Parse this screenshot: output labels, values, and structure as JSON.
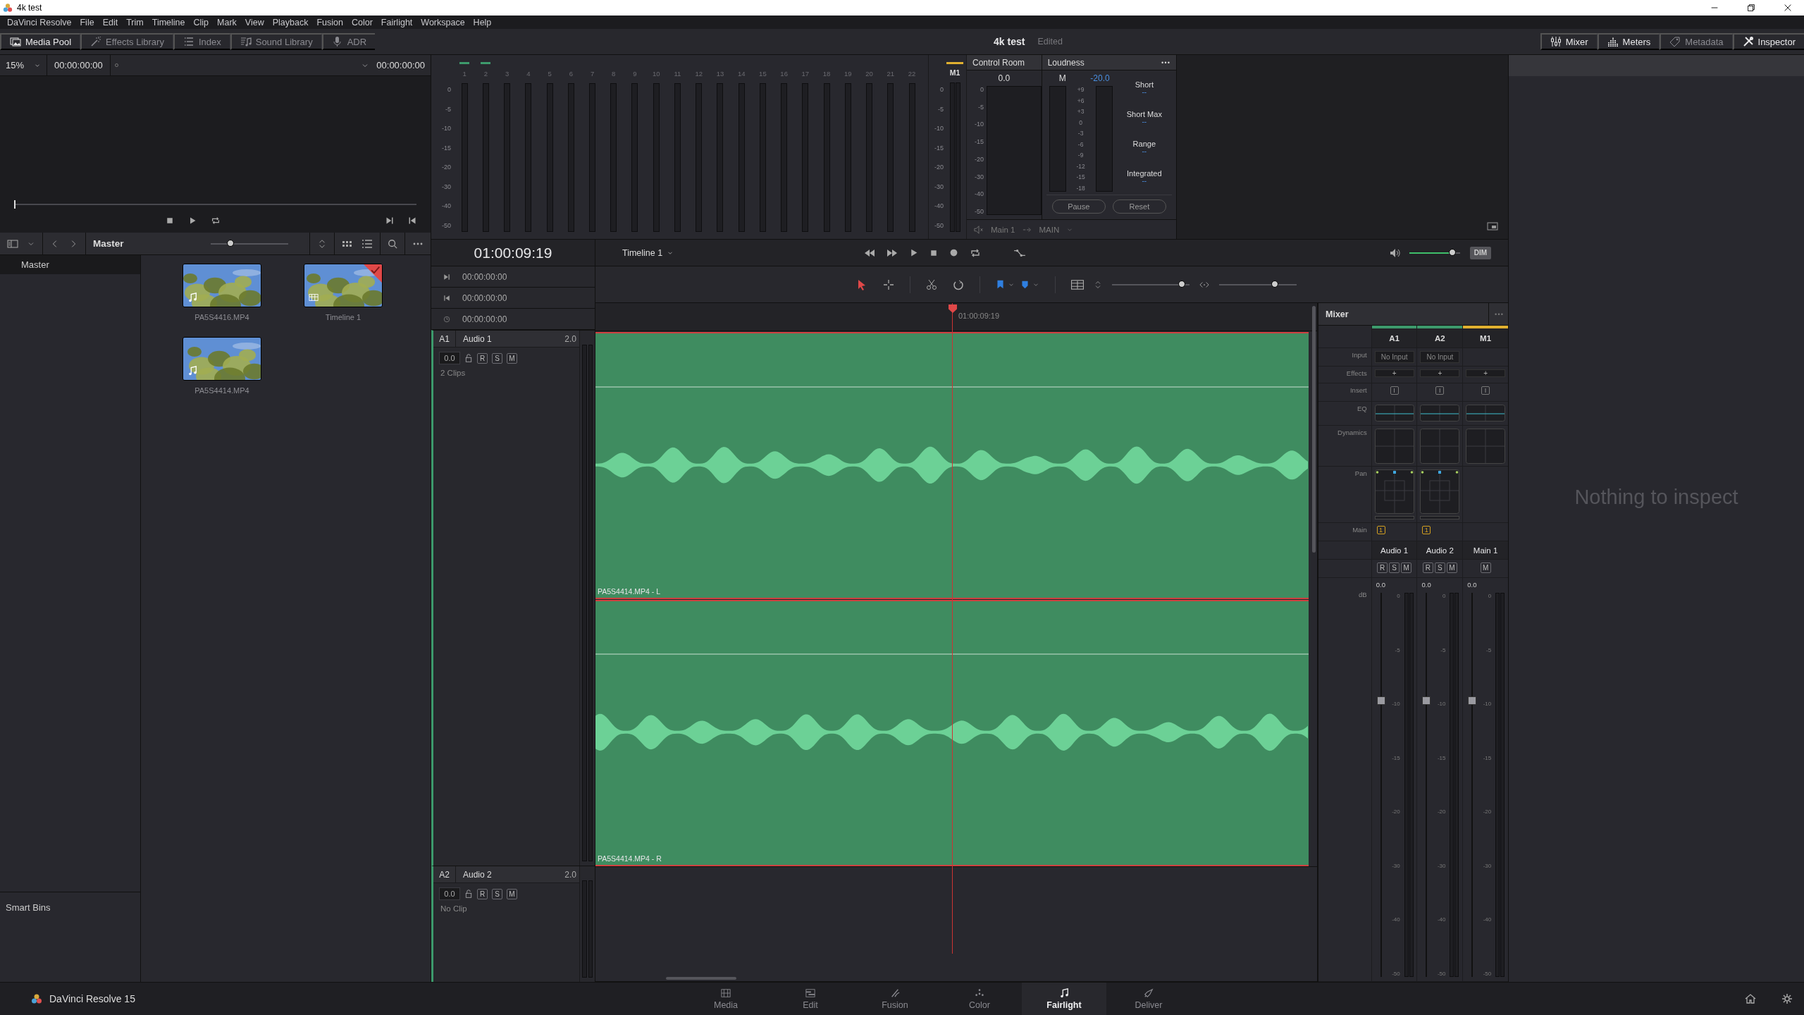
{
  "window": {
    "title": "4k test"
  },
  "menu": [
    "DaVinci Resolve",
    "File",
    "Edit",
    "Trim",
    "Timeline",
    "Clip",
    "Mark",
    "View",
    "Playback",
    "Fusion",
    "Color",
    "Fairlight",
    "Workspace",
    "Help"
  ],
  "toolbar": {
    "left": [
      {
        "label": "Media Pool",
        "kind": "media",
        "active": true
      },
      {
        "label": "Effects Library",
        "kind": "effects",
        "active": false
      },
      {
        "label": "Index",
        "kind": "index",
        "active": false
      },
      {
        "label": "Sound Library",
        "kind": "sound",
        "active": false
      },
      {
        "label": "ADR",
        "kind": "adr",
        "active": false
      }
    ],
    "project": "4k test",
    "status": "Edited",
    "right": [
      {
        "label": "Mixer",
        "kind": "mixer",
        "active": true
      },
      {
        "label": "Meters",
        "kind": "meters",
        "active": true
      },
      {
        "label": "Metadata",
        "kind": "metadata",
        "active": false
      },
      {
        "label": "Inspector",
        "kind": "inspector",
        "active": true
      }
    ]
  },
  "viewer": {
    "zoom": "15%",
    "timecode": "00:00:00:00",
    "duration": "00:00:00:00",
    "level": 0
  },
  "media_pool": {
    "path": "Master",
    "zoom": {
      "level": 0.25
    },
    "bins": [
      {
        "label": "Master",
        "selected": true
      }
    ],
    "smart_bins": "Smart Bins",
    "clips": [
      {
        "name": "PA5S4416.MP4",
        "kind": "audio",
        "current": false
      },
      {
        "name": "Timeline 1",
        "kind": "timeline",
        "current": true
      },
      {
        "name": "PA5S4414.MP4",
        "kind": "audio",
        "current": false
      }
    ]
  },
  "meters": {
    "scale": [
      "0",
      "-5",
      "-10",
      "-15",
      "-20",
      "-30",
      "-40",
      "-50"
    ],
    "channels": [
      {
        "label": "1",
        "assigned": true
      },
      {
        "label": "2",
        "assigned": true
      },
      {
        "label": "3",
        "assigned": false
      },
      {
        "label": "4",
        "assigned": false
      },
      {
        "label": "5",
        "assigned": false
      },
      {
        "label": "6",
        "assigned": false
      },
      {
        "label": "7",
        "assigned": false
      },
      {
        "label": "8",
        "assigned": false
      },
      {
        "label": "9",
        "assigned": false
      },
      {
        "label": "10",
        "assigned": false
      },
      {
        "label": "11",
        "assigned": false
      },
      {
        "label": "12",
        "assigned": false
      },
      {
        "label": "13",
        "assigned": false
      },
      {
        "label": "14",
        "assigned": false
      },
      {
        "label": "15",
        "assigned": false
      },
      {
        "label": "16",
        "assigned": false
      },
      {
        "label": "17",
        "assigned": false
      },
      {
        "label": "18",
        "assigned": false
      },
      {
        "label": "19",
        "assigned": false
      },
      {
        "label": "20",
        "assigned": false
      },
      {
        "label": "21",
        "assigned": false
      },
      {
        "label": "22",
        "assigned": false
      }
    ],
    "main": {
      "label": "M1",
      "scale": [
        "0",
        "-5",
        "-10",
        "-15",
        "-20",
        "-30",
        "-40",
        "-50"
      ]
    }
  },
  "control_room": {
    "title": "Control Room",
    "reading": "0.0",
    "scale": [
      "0",
      "-5",
      "-10",
      "-15",
      "-20",
      "-30",
      "-40",
      "-50"
    ],
    "output": "Main 1",
    "bus": "MAIN"
  },
  "loudness": {
    "title": "Loudness",
    "channel": "M",
    "target": "-20.0",
    "scale": [
      "+9",
      "+6",
      "+3",
      "0",
      "-3",
      "-6",
      "-9",
      "-12",
      "-15",
      "-18"
    ],
    "readings": [
      {
        "label": "Short",
        "value": "--"
      },
      {
        "label": "Short Max",
        "value": "--"
      },
      {
        "label": "Range",
        "value": "--"
      },
      {
        "label": "Integrated",
        "value": "--"
      }
    ],
    "buttons": [
      "Pause",
      "Reset"
    ]
  },
  "timeline": {
    "timecode": "01:00:09:19",
    "name": "Timeline 1",
    "times": [
      "00:00:00:00",
      "00:00:00:00",
      "00:00:00:00"
    ],
    "playhead": "01:00:09:19",
    "monitor": {
      "level": 0.85,
      "dim": "DIM"
    },
    "zoom": [
      {
        "level": 0.9
      },
      {
        "level": 0.72
      }
    ],
    "tracks": [
      {
        "id": "A1",
        "name": "Audio 1",
        "format": "2.0",
        "volume": "0.0",
        "buttons": [
          "R",
          "S",
          "M"
        ],
        "info": "2 Clips",
        "clips": [
          {
            "label": "PA5S4414.MP4 - L"
          },
          {
            "label": "PA5S4414.MP4 - R"
          }
        ]
      },
      {
        "id": "A2",
        "name": "Audio 2",
        "format": "2.0",
        "volume": "0.0",
        "buttons": [
          "R",
          "S",
          "M"
        ],
        "info": "No Clip"
      }
    ]
  },
  "mixer": {
    "title": "Mixer",
    "rows": [
      "Input",
      "Effects",
      "Insert",
      "EQ",
      "Dynamics",
      "Pan",
      "Main"
    ],
    "db_label": "dB",
    "strips": [
      {
        "id": "A1",
        "color": "#3d9a6c",
        "kind": "track",
        "input": "No Input",
        "effects": "+",
        "insert": "I",
        "main": "1",
        "name": "Audio 1",
        "buttons": [
          "R",
          "S",
          "M"
        ],
        "gain": "0.0",
        "level": 0.72,
        "scale": [
          "0",
          "-5",
          "-10",
          "-15",
          "-20",
          "-30",
          "-40",
          "-50"
        ]
      },
      {
        "id": "A2",
        "color": "#3d9a6c",
        "kind": "track",
        "input": "No Input",
        "effects": "+",
        "insert": "I",
        "main": "1",
        "name": "Audio 2",
        "buttons": [
          "R",
          "S",
          "M"
        ],
        "gain": "0.0",
        "level": 0.72,
        "scale": [
          "0",
          "-5",
          "-10",
          "-15",
          "-20",
          "-30",
          "-40",
          "-50"
        ]
      },
      {
        "id": "M1",
        "color": "#e0b030",
        "kind": "bus",
        "effects": "+",
        "insert": "I",
        "name": "Main 1",
        "buttons": [
          "M"
        ],
        "gain": "0.0",
        "level": 0.72,
        "scale": [
          "0",
          "-5",
          "-10",
          "-15",
          "-20",
          "-30",
          "-40",
          "-50"
        ]
      }
    ]
  },
  "inspector": {
    "message": "Nothing to inspect"
  },
  "footer": {
    "app": "DaVinci Resolve 15",
    "pages": [
      {
        "label": "Media",
        "kind": "media",
        "selected": false
      },
      {
        "label": "Edit",
        "kind": "edit",
        "selected": false
      },
      {
        "label": "Fusion",
        "kind": "fusion",
        "selected": false
      },
      {
        "label": "Color",
        "kind": "color",
        "selected": false
      },
      {
        "label": "Fairlight",
        "kind": "fairlight",
        "selected": true
      },
      {
        "label": "Deliver",
        "kind": "deliver",
        "selected": false
      }
    ]
  }
}
